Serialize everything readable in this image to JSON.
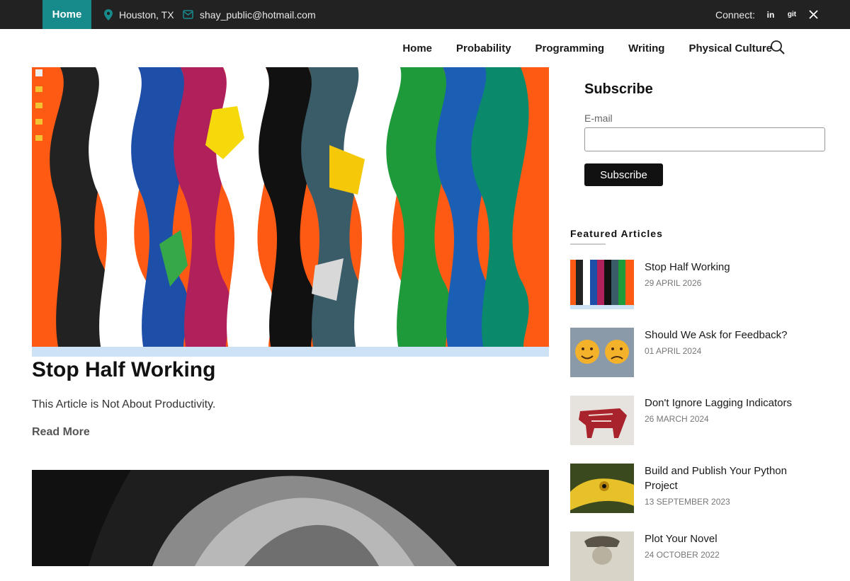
{
  "topbar": {
    "home_label": "Home",
    "location": "Houston, TX",
    "email": "shay_public@hotmail.com",
    "connect_label": "Connect:",
    "social": [
      "linkedin-icon",
      "git-icon",
      "x-icon"
    ],
    "accent_color": "#178a8c"
  },
  "nav": {
    "items": [
      "Home",
      "Probability",
      "Programming",
      "Writing",
      "Physical Culture"
    ]
  },
  "main": {
    "post_title": "Stop Half Working",
    "post_excerpt": "This Article is Not About Productivity.",
    "read_more": "Read More"
  },
  "sidebar": {
    "subscribe_title": "Subscribe",
    "email_label": "E-mail",
    "subscribe_button": "Subscribe",
    "featured_title": "Featured Articles",
    "featured": [
      {
        "title": "Stop Half Working",
        "date": "29 April 2026"
      },
      {
        "title": "Should We Ask for Feedback?",
        "date": "01 April 2024"
      },
      {
        "title": "Don't Ignore Lagging Indicators",
        "date": "26 March 2024"
      },
      {
        "title": "Build and Publish Your Python Project",
        "date": "13 September 2023"
      },
      {
        "title": "Plot Your Novel",
        "date": "24 October 2022"
      }
    ]
  }
}
